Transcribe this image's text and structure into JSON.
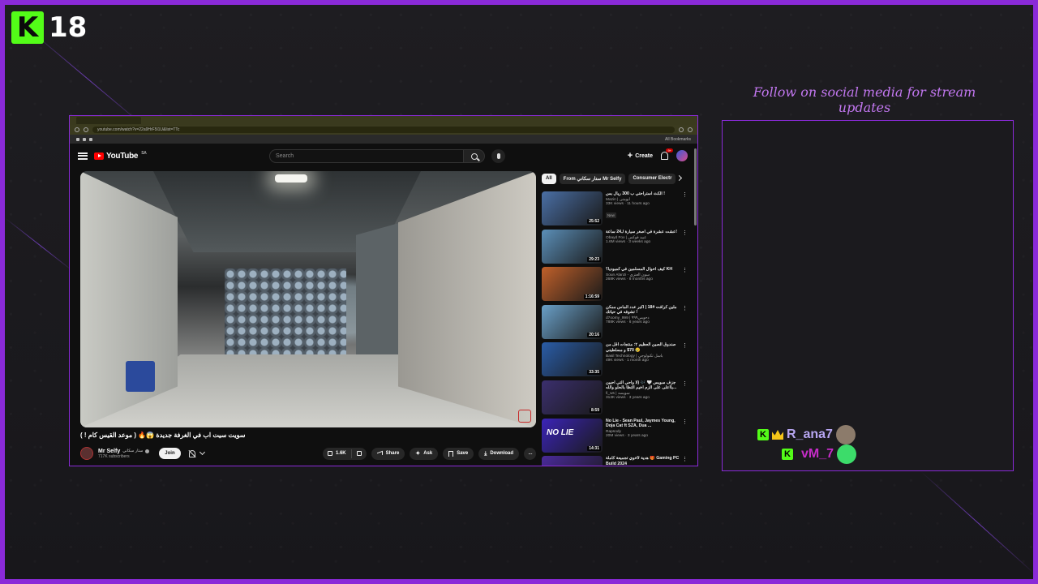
{
  "overlay": {
    "kick_badge": "K",
    "age_rating": "18",
    "follow_text": "Follow on social media for stream updates",
    "accent_color": "#8a2ad8",
    "kick_green": "#53fc18",
    "chat": [
      {
        "user": "R_ana7",
        "color": "#b7a6f2"
      },
      {
        "user": "vM_7",
        "color": "#c62cc8"
      }
    ]
  },
  "browser": {
    "url": "youtube.com/watch?v=22a9HrF5l1U&list=TTc",
    "profile": "All Bookmarks"
  },
  "youtube": {
    "logo": "YouTube",
    "country": "SA",
    "search_placeholder": "Search",
    "create_label": "Create",
    "notif_count": "9+",
    "video": {
      "title": "سويت سيت اب في الغرفة جديدة 😱🔥 ( موعد القيس كام ! )",
      "channel": "Mr Selfy",
      "channel_alt": "ستار سكاني",
      "subscribers": "717K subscribers",
      "join_label": "Join",
      "likes": "1.6K",
      "share_label": "Share",
      "ask_label": "Ask",
      "save_label": "Save",
      "download_label": "Download"
    },
    "chips": [
      "All",
      "From ستار سكاني Mr Selfy",
      "Consumer Electr"
    ],
    "related": [
      {
        "title": "الكث استراحتي ب 300 ريال بس !",
        "channel": "Mazin | ابومنى",
        "meta": "33K views · 11 hours ago",
        "badge": "New",
        "duration": "25:52",
        "thumb_color": "#4a6fa5",
        "thumb_text": ""
      },
      {
        "title": "عشت عشرة في اصغر سيارة لـ24 ساعة!",
        "channel": "Obayd Fox | عبيد فوكس",
        "meta": "1.6M views · 3 weeks ago",
        "badge": "",
        "duration": "29:23",
        "thumb_color": "#5b8fb8",
        "thumb_text": ""
      },
      {
        "title": "كيف احوال المسلمين في كمبوديا؟ KH",
        "channel": "Soun Alanzi - سون العنزي",
        "meta": "268K views · 8 months ago",
        "badge": "",
        "duration": "1:16:59",
        "thumb_color": "#c0602a",
        "thumb_text": ""
      },
      {
        "title": "ملين كرافت #18 | اكبر عدد الماس ممكن تشوفه في حياتك !",
        "channel": "d7oomy_999 | دحومي٩٩٩",
        "meta": "788K views · 6 years ago",
        "badge": "",
        "duration": "20:16",
        "thumb_color": "#6aa0c8",
        "thumb_text": ""
      },
      {
        "title": "صندوق الصين العظيم ٢: منتجات اقل من 70$ و مسلطيني 😢",
        "channel": "Basil Technology | باسل تكنولوجي",
        "meta": "49K views · 1 month ago",
        "badge": "",
        "duration": "33:35",
        "thumb_color": "#2a5da8",
        "thumb_text": ""
      },
      {
        "title": "جزف سويس 🤍 🎶 (لا واحي التي احبين يااعلى على الزم اخيم التظا بالحلو والله...",
        "channel": "fi_ws | سويسه",
        "meta": "313K views · 3 years ago",
        "badge": "",
        "duration": "8:59",
        "thumb_color": "#3b2f6e",
        "thumb_text": ""
      },
      {
        "title": "No Lie - Sean Paul, Jaymes Young, Doja Cat ft SZA, Dua ...",
        "channel": "Rapsody",
        "meta": "20M views · 3 years ago",
        "badge": "",
        "duration": "14:31",
        "thumb_color": "#3b24b8",
        "thumb_text": "NO LIE"
      },
      {
        "title": "هدية لأخوي تجميعة كاملة 🎁 Gaming PC Build 2024",
        "channel": "",
        "meta": "",
        "badge": "",
        "duration": "",
        "thumb_color": "#4a2a9a",
        "thumb_text": ""
      }
    ]
  }
}
